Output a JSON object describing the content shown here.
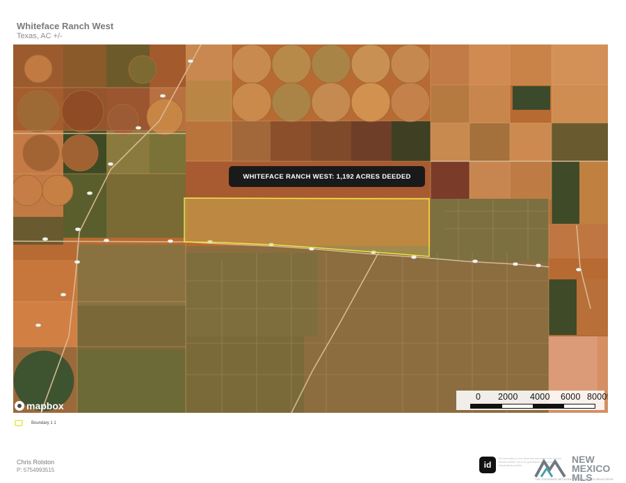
{
  "header": {
    "title": "Whiteface Ranch West",
    "subtitle": "Texas, AC +/-"
  },
  "map": {
    "callout": "WHITEFACE RANCH WEST: 1,192 ACRES DEEDED",
    "attribution": "mapbox",
    "scale_labels": [
      "0",
      "2000",
      "4000",
      "6000",
      "8000ft"
    ],
    "boundary_color": "#e8e84a"
  },
  "legend": {
    "label": "Boundary 1 1",
    "swatch_color": "#e8e84a"
  },
  "footer": {
    "agent_name": "Chris Rolston",
    "agent_phone": "P: 5754993515",
    "id_badge": "id",
    "logo": {
      "line1": "NEW",
      "line2": "MEXICO MLS",
      "tagline": "THE STATEWIDE NETWORK OF NEW MEXICO REALTORS®"
    },
    "disclaimer": "The information on this sheet has been taken from sources deemed reliable, but is not guaranteed and should be independently verified."
  }
}
